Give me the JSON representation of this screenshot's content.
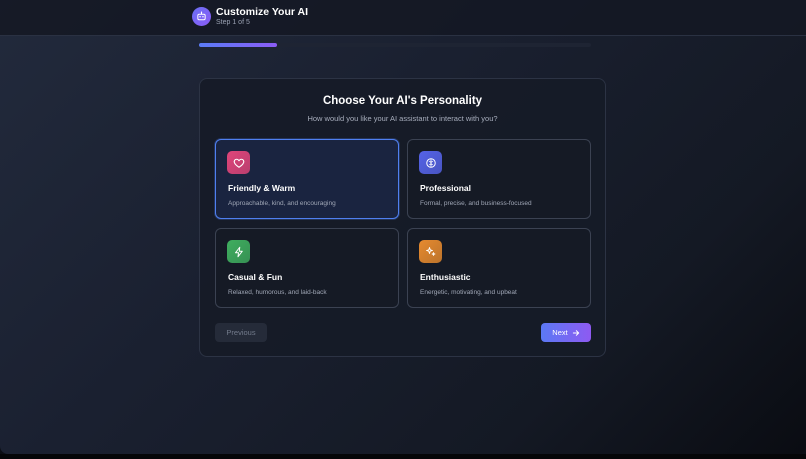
{
  "header": {
    "title": "Customize Your AI",
    "step": "Step 1 of 5"
  },
  "progress": {
    "fraction": 0.2
  },
  "panel": {
    "title": "Choose Your AI's Personality",
    "subtitle": "How would you like your AI assistant to interact with you?"
  },
  "options": [
    {
      "name": "Friendly & Warm",
      "desc": "Approachable, kind, and encouraging",
      "icon": "heart-icon",
      "color": "#e0457a",
      "selected": true
    },
    {
      "name": "Professional",
      "desc": "Formal, precise, and business-focused",
      "icon": "brain-icon",
      "color": "#5563e8",
      "selected": false
    },
    {
      "name": "Casual & Fun",
      "desc": "Relaxed, humorous, and laid-back",
      "icon": "lightning-icon",
      "color": "#3fae5f",
      "selected": false
    },
    {
      "name": "Enthusiastic",
      "desc": "Energetic, motivating, and upbeat",
      "icon": "sparkles-icon",
      "color": "#e68a2e",
      "selected": false
    }
  ],
  "nav": {
    "previous_label": "Previous",
    "next_label": "Next"
  },
  "colors": {
    "accent": "#5b7cf7",
    "accent2": "#8b5cf6",
    "selected_border": "#4f7ff0"
  }
}
